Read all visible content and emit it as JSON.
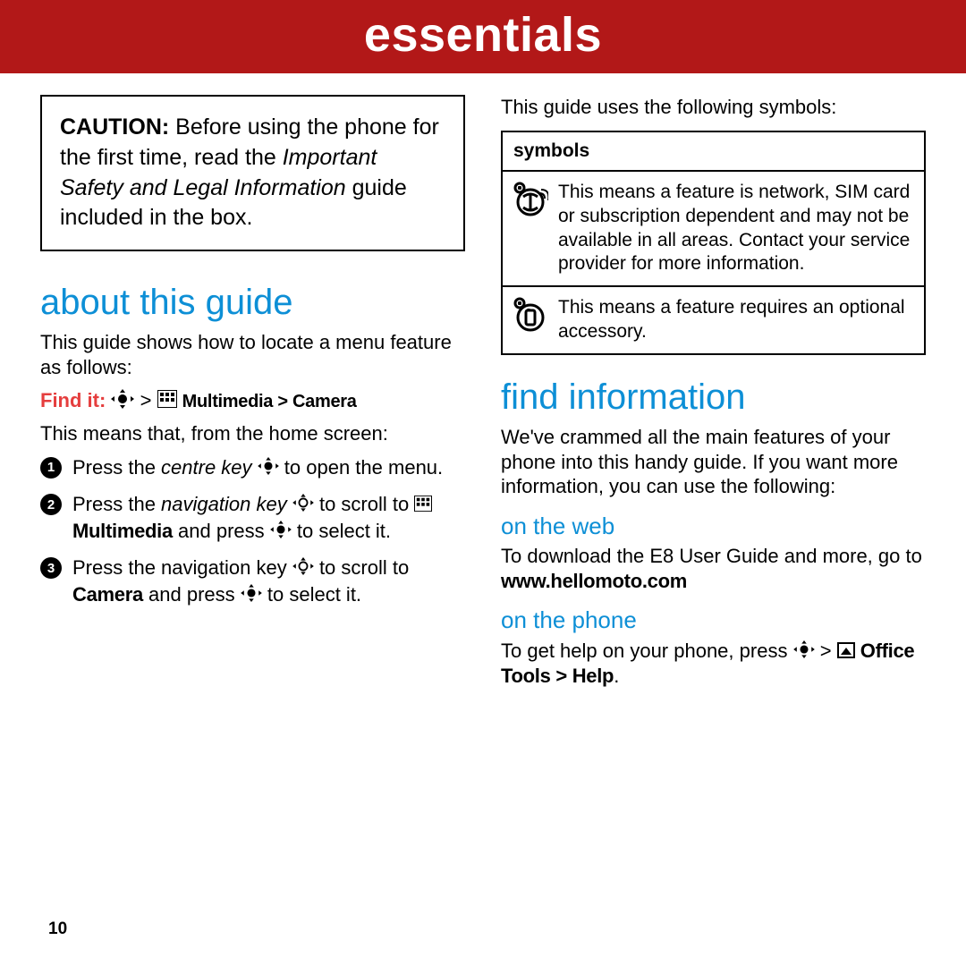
{
  "banner": "essentials",
  "page_number": "10",
  "caution": {
    "bold": "CAUTION:",
    "t1": " Before using the phone for the first time, read the ",
    "italic": "Important Safety and Legal Information",
    "t2": " guide included in the box."
  },
  "about": {
    "heading": "about this guide",
    "p1": "This guide shows how to locate a menu feature as follows:",
    "findit_label": "Find it:",
    "findit_path1": " Multimedia > Camera",
    "p2": "This means that, from the home screen:",
    "steps": [
      {
        "n": "1",
        "a": "Press the ",
        "ital": "centre key",
        "b": " to open the menu."
      },
      {
        "n": "2",
        "a": "Press the ",
        "ital": "navigation key",
        "b": " to scroll to ",
        "bold": "Multimedia",
        "c": " and press ",
        "d": " to select it."
      },
      {
        "n": "3",
        "a": "Press the navigation key ",
        "b": " to scroll to ",
        "bold": "Camera",
        "c": " and press ",
        "d": " to select it."
      }
    ]
  },
  "symbols_intro": "This guide uses the following symbols:",
  "symbols": {
    "header": "symbols",
    "rows": [
      "This means a feature is network, SIM card or subscription dependent and may not be available in all areas. Contact your service provider for more information.",
      "This means a feature requires an optional accessory."
    ]
  },
  "find_info": {
    "heading": "find information",
    "p1": "We've crammed all the main features of your phone into this handy guide. If you want more information, you can use the following:",
    "web_h": "on the web",
    "web_t1": "To download the E8 User Guide and more, go to ",
    "web_link": "www.hellomoto.com",
    "phone_h": "on the phone",
    "phone_t1": "To get help on your phone, press ",
    "phone_path": "Office Tools > Help",
    "gt": " > "
  }
}
